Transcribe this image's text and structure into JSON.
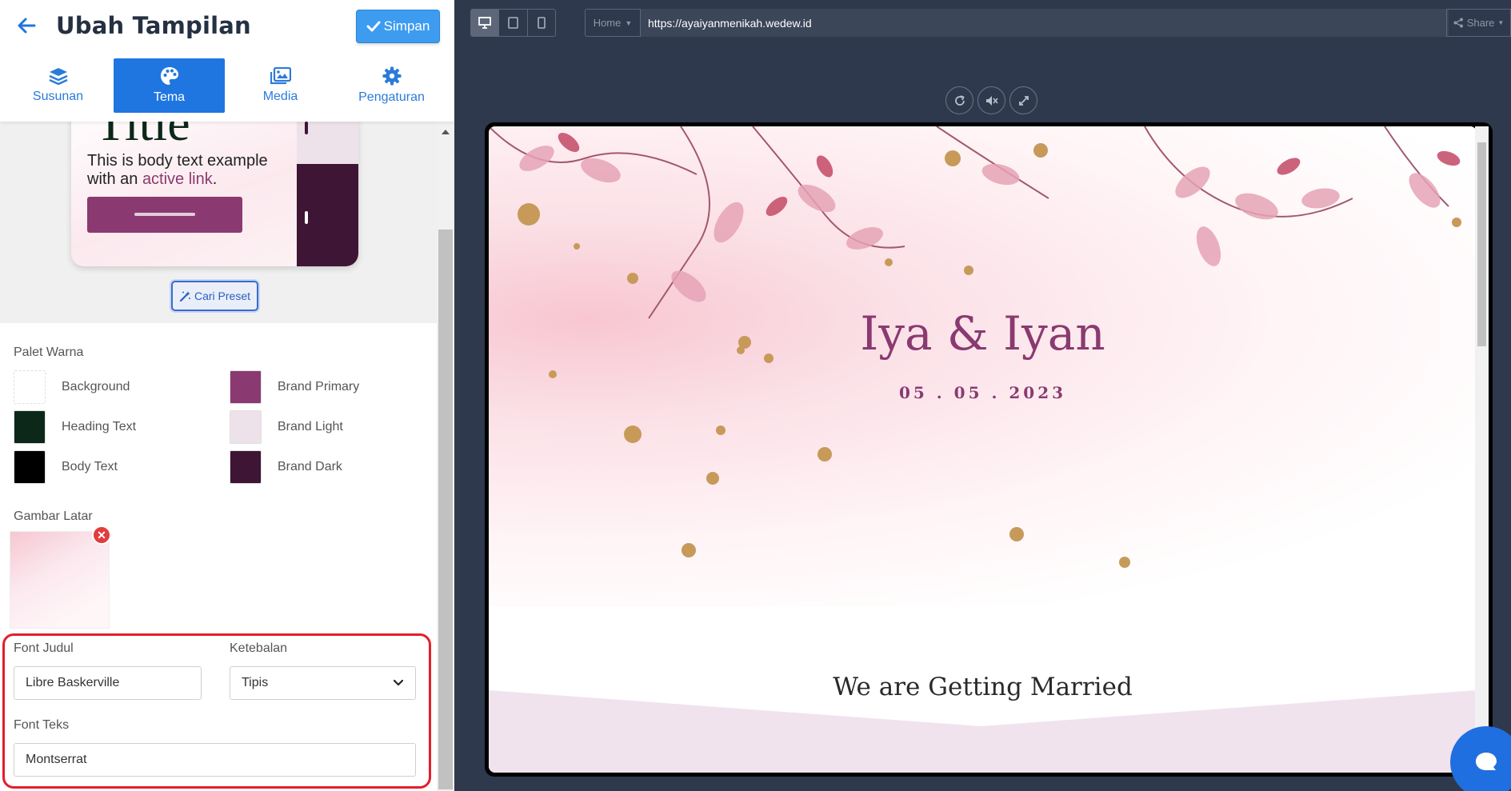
{
  "header": {
    "title": "Ubah Tampilan",
    "save_label": "Simpan"
  },
  "tabs": [
    {
      "label": "Susunan",
      "icon": "layers-icon"
    },
    {
      "label": "Tema",
      "icon": "palette-icon",
      "active": true
    },
    {
      "label": "Media",
      "icon": "images-icon"
    },
    {
      "label": "Pengaturan",
      "icon": "gear-icon"
    }
  ],
  "preview": {
    "title": "Title",
    "body_prefix": "This is body text example with an ",
    "body_link": "active link",
    "body_suffix": ".",
    "preset_label": "Cari Preset"
  },
  "palette": {
    "label": "Palet Warna",
    "items": [
      {
        "label": "Background",
        "color": "#ffffff"
      },
      {
        "label": "Brand Primary",
        "color": "#8a3a70"
      },
      {
        "label": "Heading Text",
        "color": "#0c2818"
      },
      {
        "label": "Brand Light",
        "color": "#ede2ea"
      },
      {
        "label": "Body Text",
        "color": "#000000"
      },
      {
        "label": "Brand Dark",
        "color": "#3e1535"
      }
    ]
  },
  "background_image": {
    "label": "Gambar Latar"
  },
  "fonts": {
    "heading_label": "Font Judul",
    "heading_value": "Libre Baskerville",
    "weight_label": "Ketebalan",
    "weight_value": "Tipis",
    "body_label": "Font Teks",
    "body_value": "Montserrat",
    "highlight_color": "#e21f2b"
  },
  "browser": {
    "page_dropdown": "Home",
    "url": "https://ayaiyanmenikah.wedew.id",
    "share_label": "Share"
  },
  "invitation": {
    "couple": "Iya & Iyan",
    "date": "05 . 05 . 2023",
    "tagline": "We are Getting Married",
    "accent": "#8a3a70",
    "section_bg": "#f0e3ee"
  }
}
